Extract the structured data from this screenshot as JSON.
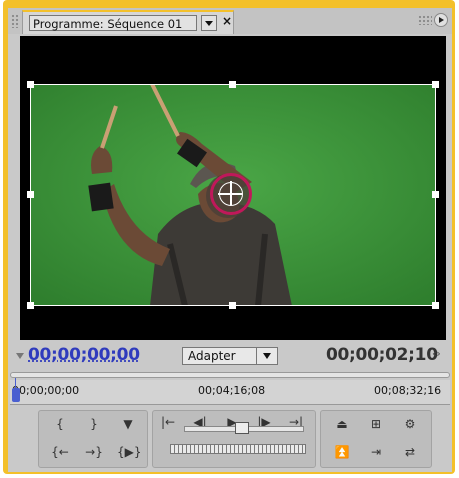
{
  "panel": {
    "tab_title": "Programme: Séquence 01",
    "tab_close": "×"
  },
  "timecode": {
    "current": "00;00;00;00",
    "duration": "00;00;02;10"
  },
  "zoom": {
    "selected": "Adapter"
  },
  "ruler": {
    "labels": [
      "00;00;00;00",
      "00;04;16;08",
      "00;08;32;16"
    ]
  },
  "colors": {
    "panel_border": "#f3c02a",
    "timecode_current": "#2f3bbd",
    "anchor_circle": "#c0185a",
    "green_screen": "#3f9a3a"
  },
  "icons": {
    "left_group": [
      "mark-in-icon",
      "mark-out-icon",
      "set-marker-icon",
      "go-to-in-icon",
      "go-to-out-icon",
      "play-in-to-out-icon"
    ],
    "center_group": [
      "step-back-to-in-icon",
      "step-back-icon",
      "play-icon",
      "step-forward-icon",
      "step-to-out-icon"
    ],
    "right_group": [
      "lift-icon",
      "safe-margins-icon",
      "output-icon",
      "extract-icon",
      "trim-icon",
      "export-frame-icon"
    ]
  }
}
